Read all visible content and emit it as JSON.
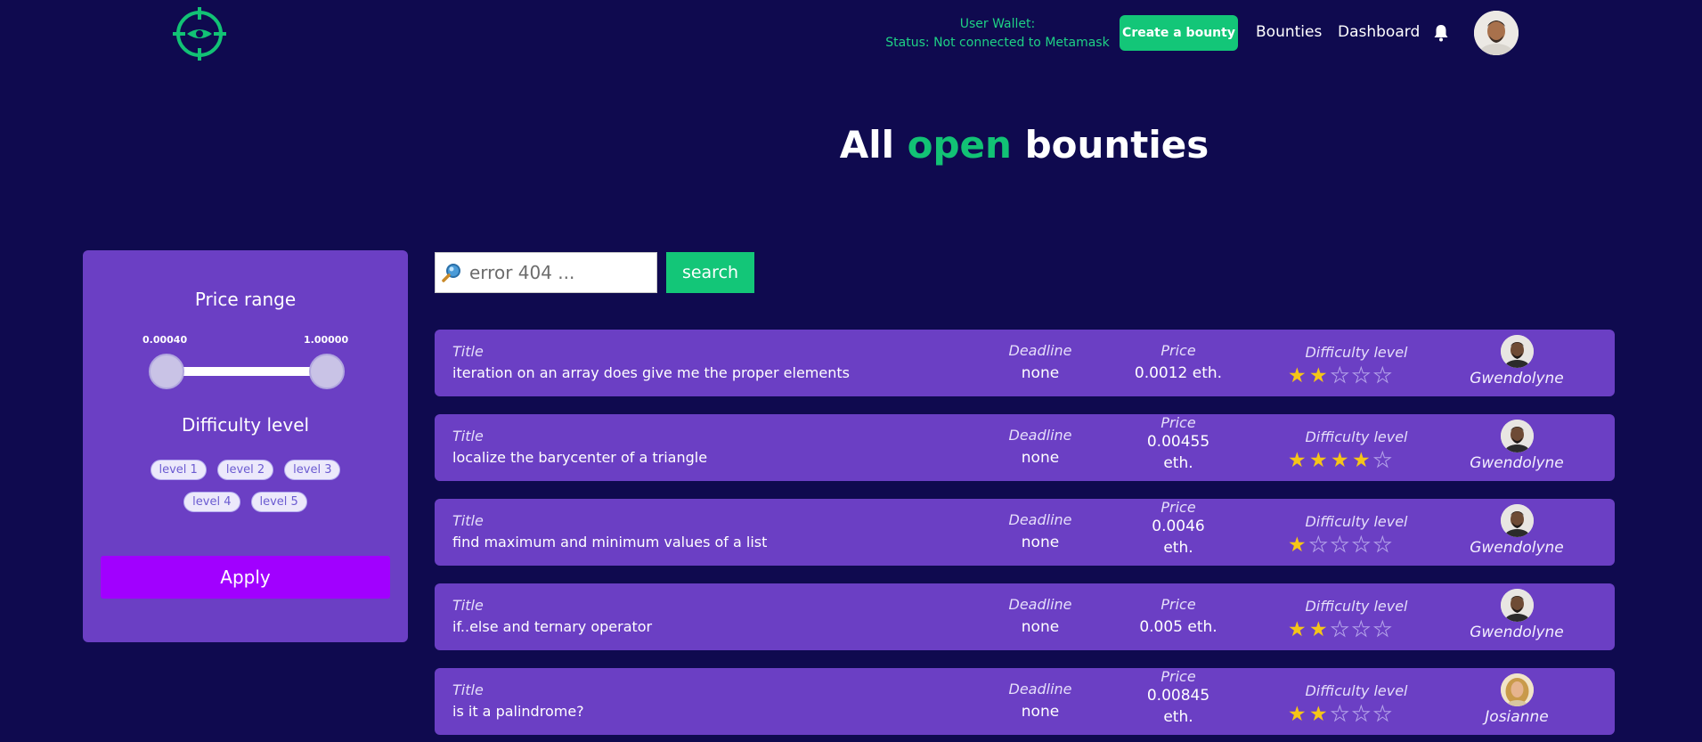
{
  "header": {
    "logo_icon": "crosshair-eye-logo",
    "wallet_line1": "User Wallet:",
    "wallet_line2": "Status: Not connected to Metamask",
    "create_button": "Create a bounty",
    "nav_bounties": "Bounties",
    "nav_dashboard": "Dashboard",
    "bell_icon": "bell-icon",
    "avatar_icon": "user-avatar"
  },
  "heading": {
    "part1": "All ",
    "highlight": "open",
    "part2": " bounties"
  },
  "filter": {
    "price_title": "Price range",
    "range_min": "0.00040",
    "range_max": "1.00000",
    "difficulty_title": "Difficulty level",
    "levels": [
      "level 1",
      "level 2",
      "level 3",
      "level 4",
      "level 5"
    ],
    "apply_button": "Apply"
  },
  "search": {
    "placeholder": "error 404 ...",
    "button": "search"
  },
  "labels": {
    "title": "Title",
    "deadline": "Deadline",
    "price": "Price",
    "difficulty": "Difficulty level"
  },
  "bounties": [
    {
      "title": "iteration on an array does give me the proper elements",
      "deadline": "none",
      "price_line1": "0.0012 eth.",
      "price_line2": "",
      "difficulty": 2,
      "user": "Gwendolyne",
      "avatar": "man"
    },
    {
      "title": "localize the barycenter of a triangle",
      "deadline": "none",
      "price_line1": "0.00455",
      "price_line2": "eth.",
      "difficulty": 4,
      "user": "Gwendolyne",
      "avatar": "man"
    },
    {
      "title": "find maximum and minimum values of a list",
      "deadline": "none",
      "price_line1": "0.0046",
      "price_line2": "eth.",
      "difficulty": 1,
      "user": "Gwendolyne",
      "avatar": "man"
    },
    {
      "title": "if..else and ternary operator",
      "deadline": "none",
      "price_line1": "0.005 eth.",
      "price_line2": "",
      "difficulty": 2,
      "user": "Gwendolyne",
      "avatar": "man"
    },
    {
      "title": "is it a palindrome?",
      "deadline": "none",
      "price_line1": "0.00845",
      "price_line2": "eth.",
      "difficulty": 2,
      "user": "Josianne",
      "avatar": "woman"
    }
  ],
  "colors": {
    "background": "#0f0a4f",
    "accent_green": "#13c678",
    "card_purple": "#6b3fc4",
    "apply_purple": "#a100ff",
    "star_yellow": "#f5c518"
  }
}
